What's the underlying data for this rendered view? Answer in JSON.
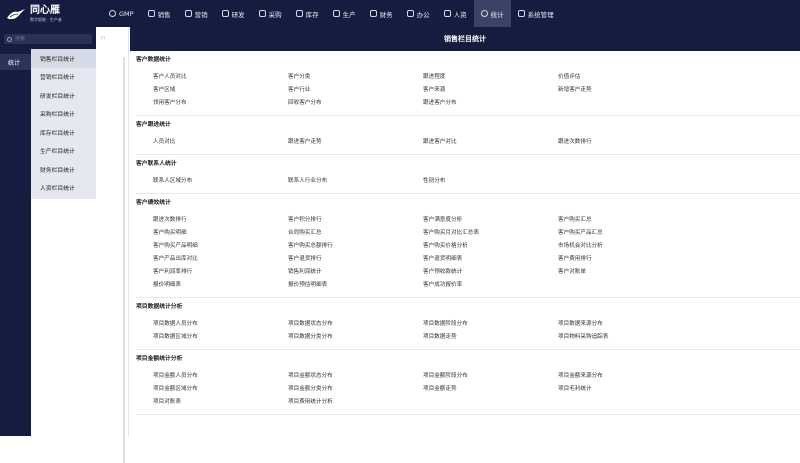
{
  "app": {
    "logo_name": "同心雁",
    "logo_sub": "数字赋能 · 生产者"
  },
  "nav": [
    {
      "label": "GMP",
      "icon": "gear-icon",
      "active": false
    },
    {
      "label": "销售",
      "icon": "sales-icon",
      "active": false
    },
    {
      "label": "营销",
      "icon": "marketing-icon",
      "active": false
    },
    {
      "label": "研发",
      "icon": "rd-icon",
      "active": false
    },
    {
      "label": "采购",
      "icon": "purchase-icon",
      "active": false
    },
    {
      "label": "库存",
      "icon": "inventory-icon",
      "active": false
    },
    {
      "label": "生产",
      "icon": "production-icon",
      "active": false
    },
    {
      "label": "财务",
      "icon": "finance-icon",
      "active": false
    },
    {
      "label": "办公",
      "icon": "office-icon",
      "active": false
    },
    {
      "label": "人资",
      "icon": "hr-icon",
      "active": false
    },
    {
      "label": "统计",
      "icon": "stats-icon",
      "active": true
    },
    {
      "label": "系统管理",
      "icon": "settings-icon",
      "active": false
    }
  ],
  "sidebar": {
    "search_placeholder": "搜索",
    "category": "统计",
    "items": [
      {
        "label": "销售栏目统计",
        "active": true
      },
      {
        "label": "营销栏目统计",
        "active": false
      },
      {
        "label": "研发栏目统计",
        "active": false
      },
      {
        "label": "采购栏目统计",
        "active": false
      },
      {
        "label": "库存栏目统计",
        "active": false
      },
      {
        "label": "生产栏目统计",
        "active": false
      },
      {
        "label": "财务栏目统计",
        "active": false
      },
      {
        "label": "人资栏目统计",
        "active": false
      }
    ]
  },
  "gutter_mark": "口",
  "main": {
    "title": "销售栏目统计",
    "sections": [
      {
        "title": "客户数据统计",
        "links": [
          "客户人员对比",
          "客户分类",
          "跟进程度",
          "价值评估",
          "客户区域",
          "客户行业",
          "客户来源",
          "新增客户走势",
          "领用客户分布",
          "回收客户分布",
          "跟进客户分布"
        ]
      },
      {
        "title": "客户跟进统计",
        "links": [
          "人员对比",
          "跟进客户走势",
          "跟进客户对比",
          "跟进次数排行"
        ]
      },
      {
        "title": "客户联系人统计",
        "links": [
          "联系人区域分布",
          "联系人行业分布",
          "性别分布"
        ]
      },
      {
        "title": "客户绩效统计",
        "links": [
          "跟进次数排行",
          "客户积分排行",
          "客户满意度分析",
          "客户购买汇总",
          "客户购买明细",
          "合同购买汇总",
          "客户购买月对比汇总表",
          "客户购买产品汇总",
          "客户购买产品明细",
          "客户购买总额排行",
          "客户购买价格分析",
          "市场机会对比分析",
          "客户产品出库对比",
          "客户退货排行",
          "客户退货明细表",
          "客户费用排行",
          "客户利润率排行",
          "销售利润统计",
          "客户预收款统计",
          "客户对账单",
          "报价明细表",
          "报价预估明细表",
          "客户成功报价率"
        ]
      },
      {
        "title": "项目数据统计分析",
        "links": [
          "项目数据人员分布",
          "项目数据状态分布",
          "项目数据阶段分布",
          "项目数据来源分布",
          "项目数据区域分布",
          "项目数据分类分布",
          "项目数据走势",
          "项目物料采购追踪表"
        ]
      },
      {
        "title": "项目金额统计分析",
        "links": [
          "项目金额人员分布",
          "项目金额状态分布",
          "项目金额阶段分布",
          "项目金额来源分布",
          "项目金额区域分布",
          "项目金额分类分布",
          "项目金额走势",
          "项目毛利统计",
          "项目对账表",
          "项目费用统计分析"
        ]
      }
    ]
  }
}
